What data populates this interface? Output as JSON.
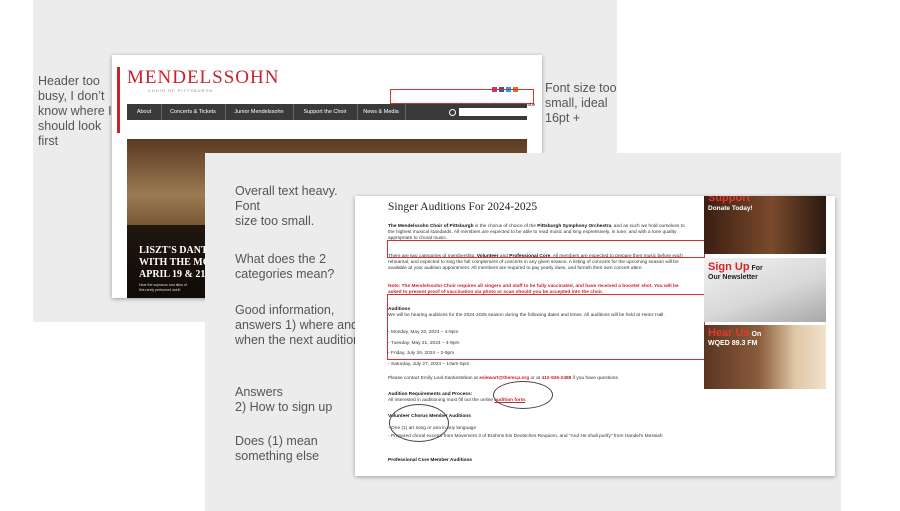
{
  "slide1": {
    "note_left": "Header too\nbusy, I don’t\nknow where I\nshould look\nfirst",
    "note_right": "Font size too\nsmall, ideal\n16pt +",
    "site": {
      "logo": "MENDELSSOHN",
      "logo_sub": "CHOIR OF PITTSBURGH",
      "top_links": [
        "Home",
        "Contact",
        "Choir Login",
        "Give",
        "E-Subscribe"
      ],
      "main_nav": [
        "About",
        "Concerts & Tickets",
        "Junior Mendelssohn",
        "Support the Choir",
        "News & Media"
      ],
      "hero_title_lines": [
        "LISZT'S DANTE",
        "WITH THE MO",
        "APRIL 19 & 21!"
      ],
      "hero_caption_lines": [
        "Hear the sopranos and altos of",
        "this rarely performed work!"
      ]
    }
  },
  "slide2": {
    "notes": [
      "Overall text heavy. Font\nsize too small.",
      "What does the 2\ncategories mean?",
      "Good information,\nanswers 1) where and\nwhen the next audition",
      "Answers\n2) How to sign up",
      "Does (1) mean\nsomething else"
    ],
    "page": {
      "title": "Singer Auditions For 2024-2025",
      "p1_a": "The Mendelssohn Choir of Pittsburgh",
      "p1_b": " is the chorus of choice of the ",
      "p1_c": "Pittsburgh Symphony Orchestra",
      "p1_d": ", and as such we hold ourselves to the highest musical standards. All members are expected to be able to read music and sing expressively, in tune, and with a tone quality appropriate to choral music.",
      "p2_a": "There are two categories of membership, ",
      "p2_b": "Volunteer",
      "p2_c": " and ",
      "p2_d": "Professional Core",
      "p2_e": ". All members are expected to prepare their music before each rehearsal, and expected to sing the full complement of concerts in any given season. A listing of concerts for the upcoming season will be available at your audition appointment. All members are required to pay yearly dues, and furnish their own concert attire.",
      "note_red": "Note:  The Mendelssohn Choir requires all singers and staff to be fully vaccinated, and have received a booster shot.  You will be asked to present proof of vaccination via photo or scan should you be accepted into the choir.",
      "auditions_heading": "Auditions",
      "auditions_intro": "We will be hearing auditions for the 2024-2025 season during the following dates and times.  All auditions will be held at Heinz Hall.",
      "dates": [
        "Monday, May 20, 2024 – 4-9pm",
        "Tuesday, May 21, 2024 – 4-9pm",
        "Friday, July 26, 2024 – 2-9pm",
        "Saturday, July 27, 2024 – 10am-5pm"
      ],
      "contact_a": "Please contact Emily Leal-Santiesteban at ",
      "contact_email": "eslewart@themcp.org",
      "contact_b": " or at ",
      "contact_phone": "412-926-2488",
      "contact_c": " if you have questions.",
      "req_heading": "Audition Requirements and Process:",
      "req_a": "All interested in auditioning must fill out the online ",
      "req_link": "audition form",
      "req_b": ".",
      "vol_heading": "Volunteer Chorus Member Auditions",
      "vol_items": [
        "One (1) art song or aria in any language",
        "Prepared choral excerpt from Movement 3 of Brahms Ein Deutsches Requiem, and \"And He shall purify\" from Handel's Messiah"
      ],
      "pro_heading": "Professional Core Member Auditions"
    },
    "ads": [
      {
        "line1": "Support",
        "line2": "Donate Today!"
      },
      {
        "line1": "Sign Up",
        "line1b": " For",
        "line2": "Our Newsletter"
      },
      {
        "line1": "Hear Us",
        "line1b": " On",
        "line2": "WQED 89.3 FM"
      }
    ]
  },
  "colors": {
    "accent_red": "#c8232c",
    "annotation_red": "#d9302c",
    "slide_bg": "#ececec"
  }
}
